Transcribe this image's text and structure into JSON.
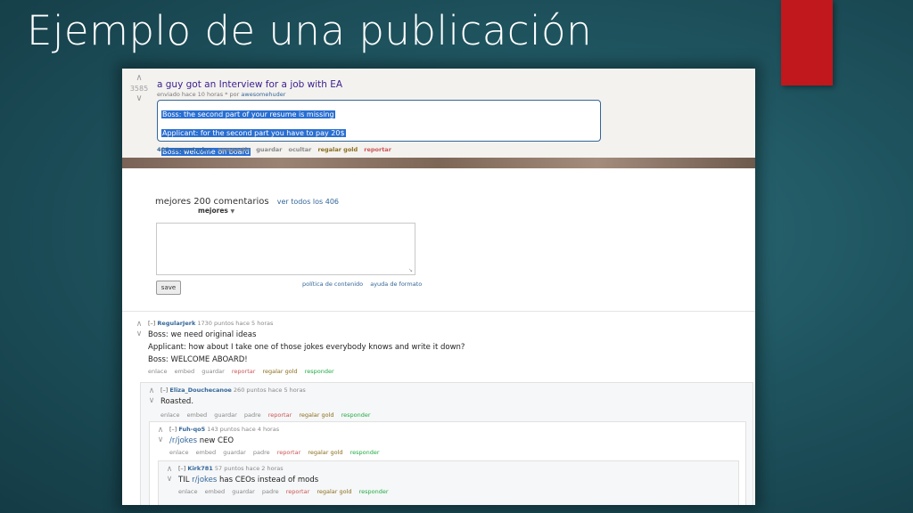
{
  "slide": {
    "title": "Ejemplo de una publicación"
  },
  "post": {
    "score": "3585",
    "title": "a guy got an Interview for a job with EA",
    "meta_prefix": "enviado hace 10 horas * por",
    "meta_author": "awesomehuder",
    "lines": [
      "Boss: the second part of your resume is missing",
      "Applicant: for the second part you have to pay 20$",
      "Boss: welcome on board"
    ],
    "actions": {
      "comments": "406 comentarios",
      "share": "compartir",
      "save": "guardar",
      "hide": "ocultar",
      "gold": "regalar gold",
      "report": "reportar"
    }
  },
  "comments_header": {
    "title": "mejores 200 comentarios",
    "view_all": "ver todos los 406",
    "sort": "mejores",
    "save_button": "save",
    "policy_link": "política de contenido",
    "format_help_link": "ayuda de formato"
  },
  "comments": [
    {
      "toggle": "[–]",
      "author": "RegularJerk",
      "meta": "1730 puntos hace 5 horas",
      "lines": [
        "Boss: we need original ideas",
        "Applicant: how about I take one of those jokes everybody knows and write it down?",
        "Boss: WELCOME ABOARD!"
      ],
      "actions": [
        "enlace",
        "embed",
        "guardar",
        "reportar",
        "regalar gold",
        "responder"
      ]
    },
    {
      "toggle": "[–]",
      "author": "Eliza_Douchecanoe",
      "meta": "260 puntos hace 5 horas",
      "lines": [
        "Roasted."
      ],
      "actions": [
        "enlace",
        "embed",
        "guardar",
        "padre",
        "reportar",
        "regalar gold",
        "responder"
      ]
    },
    {
      "toggle": "[–]",
      "author": "Fuh-qo5",
      "meta": "143 puntos hace 4 horas",
      "link": "/r/jokes",
      "text_after_link": " new CEO",
      "actions": [
        "enlace",
        "embed",
        "guardar",
        "padre",
        "reportar",
        "regalar gold",
        "responder"
      ]
    },
    {
      "toggle": "[–]",
      "author": "Kirk781",
      "meta": "57 puntos hace 2 horas",
      "text_before_link": "TIL ",
      "link": "r/jokes",
      "text_after_link": " has CEOs instead of mods",
      "actions": [
        "enlace",
        "embed",
        "guardar",
        "padre",
        "reportar",
        "regalar gold",
        "responder"
      ]
    }
  ],
  "colors": {
    "accent_red": "#c0181c",
    "link_blue": "#336699",
    "selection_blue": "#2a6fd2",
    "report_red": "#cc5555",
    "gold": "#8a6d1c",
    "reply_green": "#22aa44"
  },
  "icons": {
    "upvote": "upvote-arrow-icon",
    "downvote": "downvote-arrow-icon"
  }
}
